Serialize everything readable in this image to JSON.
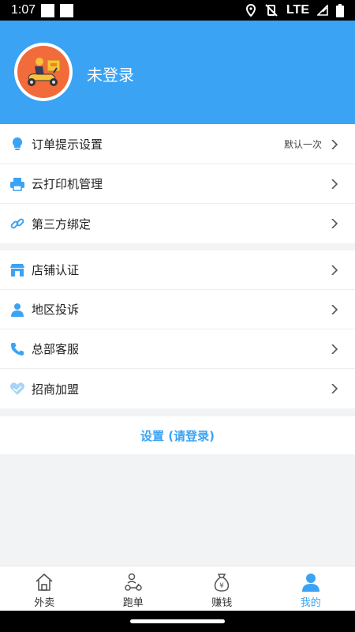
{
  "status_bar": {
    "time": "1:07",
    "network": "LTE"
  },
  "profile": {
    "login_status": "未登录"
  },
  "menu_group_1": [
    {
      "label": "订单提示设置",
      "value": "默认一次",
      "icon": "lightbulb-icon"
    },
    {
      "label": "云打印机管理",
      "value": "",
      "icon": "printer-icon"
    },
    {
      "label": "第三方绑定",
      "value": "",
      "icon": "link-icon"
    }
  ],
  "menu_group_2": [
    {
      "label": "店铺认证",
      "icon": "store-icon"
    },
    {
      "label": "地区投诉",
      "icon": "person-icon"
    },
    {
      "label": "总部客服",
      "icon": "phone-icon"
    },
    {
      "label": "招商加盟",
      "icon": "heart-hand-icon"
    }
  ],
  "settings": {
    "label": "设置 (请登录)"
  },
  "tabs": [
    {
      "label": "外卖",
      "icon": "home-icon",
      "active": false
    },
    {
      "label": "跑单",
      "icon": "courier-icon",
      "active": false
    },
    {
      "label": "赚钱",
      "icon": "money-bag-icon",
      "active": false
    },
    {
      "label": "我的",
      "icon": "user-icon",
      "active": true
    }
  ],
  "colors": {
    "primary": "#3aa3f4",
    "avatar_bg": "#f26b3a",
    "page_bg": "#f2f3f5"
  }
}
